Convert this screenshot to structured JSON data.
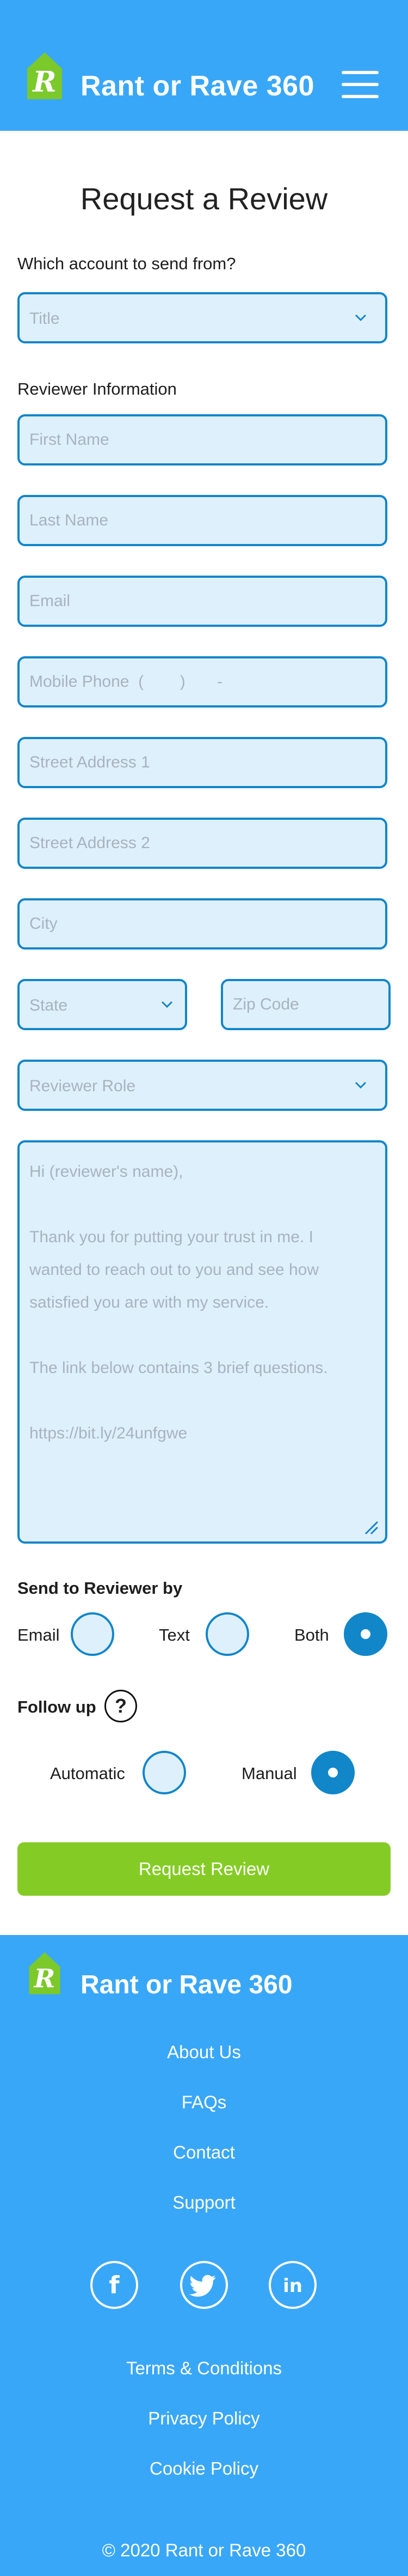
{
  "header": {
    "brand": "Rant or Rave 360",
    "logo_letter": "R"
  },
  "page": {
    "title": "Request a Review"
  },
  "form": {
    "account_label": "Which account to send from?",
    "account_select": {
      "placeholder": "Title"
    },
    "reviewer_info_label": "Reviewer Information",
    "first_name": {
      "placeholder": "First Name"
    },
    "last_name": {
      "placeholder": "Last Name"
    },
    "email": {
      "placeholder": "Email"
    },
    "mobile_phone": {
      "placeholder": "Mobile Phone  (        )       -"
    },
    "street1": {
      "placeholder": "Street Address 1"
    },
    "street2": {
      "placeholder": "Street Address 2"
    },
    "city": {
      "placeholder": "City"
    },
    "state": {
      "placeholder": "State"
    },
    "zip": {
      "placeholder": "Zip Code"
    },
    "role": {
      "placeholder": "Reviewer Role"
    },
    "message": "Hi (reviewer's name),\n\nThank you for putting your trust in me. I wanted to reach out to you and see how satisfied you are with my service.\n\nThe link below contains 3 brief questions.\n\nhttps://bit.ly/24unfgwe",
    "send_by": {
      "label": "Send to Reviewer by",
      "options": [
        {
          "label": "Email",
          "checked": false
        },
        {
          "label": "Text",
          "checked": false
        },
        {
          "label": "Both",
          "checked": true
        }
      ]
    },
    "follow_up": {
      "label": "Follow up",
      "help_glyph": "?",
      "options": [
        {
          "label": "Automatic",
          "checked": false
        },
        {
          "label": "Manual",
          "checked": true
        }
      ]
    },
    "submit_label": "Request Review"
  },
  "footer": {
    "brand": "Rant or Rave 360",
    "logo_letter": "R",
    "links": [
      "About Us",
      "FAQs",
      "Contact",
      "Support"
    ],
    "social_icons": [
      "facebook-icon",
      "twitter-icon",
      "linkedin-icon"
    ],
    "social_text": {
      "facebook": "f",
      "linkedin": "in"
    },
    "legal_links": [
      "Terms & Conditions",
      "Privacy Policy",
      "Cookie Policy"
    ],
    "copyright": "© 2020 Rant or Rave 360"
  },
  "colors": {
    "primary": "#39a7f8",
    "field_border": "#1186c9",
    "field_bg": "#dff0fd",
    "accent_green": "#84cc25"
  }
}
